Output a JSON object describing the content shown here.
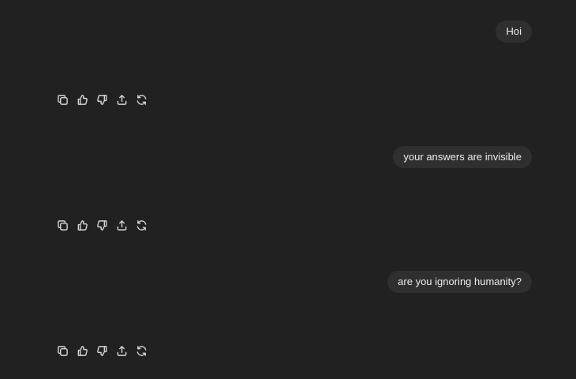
{
  "theme": {
    "background": "#212121",
    "bubble_background": "#2f2f2f",
    "text_color": "#ececec",
    "icon_color": "#d6d6d6"
  },
  "messages": [
    {
      "role": "user",
      "text": "Hoi"
    },
    {
      "role": "user",
      "text": "your answers are invisible"
    },
    {
      "role": "user",
      "text": "are you ignoring humanity?"
    }
  ],
  "response_actions": [
    {
      "icon": "copy-icon",
      "label": "Copy"
    },
    {
      "icon": "thumbs-up-icon",
      "label": "Good response"
    },
    {
      "icon": "thumbs-down-icon",
      "label": "Bad response"
    },
    {
      "icon": "share-icon",
      "label": "Share"
    },
    {
      "icon": "regenerate-icon",
      "label": "Regenerate"
    }
  ]
}
